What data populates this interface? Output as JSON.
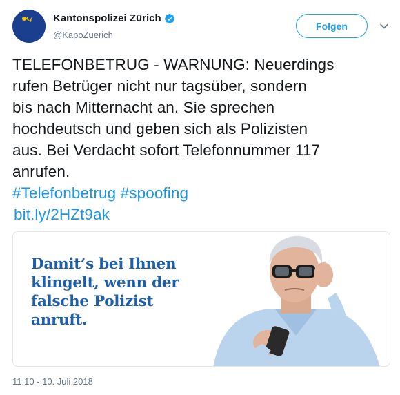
{
  "header": {
    "display_name": "Kantonspolizei Zürich",
    "handle": "@KapoZuerich",
    "avatar_text": "Kantonspolizei Zürich",
    "follow_label": "Folgen"
  },
  "tweet": {
    "text_lines": [
      "TELEFONBETRUG - WARNUNG: Neuerdings",
      "rufen Betrüger nicht nur tagsüber, sondern",
      "bis nach Mitternacht an. Sie sprechen",
      "hochdeutsch und geben sich als Polizisten",
      "aus. Bei Verdacht sofort Telefonnummer 117",
      "anrufen."
    ],
    "hashtags": [
      "#Telefonbetrug",
      "#spoofing"
    ],
    "link": "bit.ly/2HZt9ak",
    "timestamp": "11:10 - 10. Juli 2018"
  },
  "card": {
    "slogan_lines": [
      "Damit’s bei Ihnen",
      "klingelt, wenn der",
      "falsche Polizist",
      "anruft."
    ]
  },
  "colors": {
    "link": "#1b95e0",
    "follow": "#1da1f2",
    "slogan": "#1f5ea8",
    "verified": "#1da1f2"
  },
  "icons": [
    "verified-badge-icon",
    "chevron-down-icon"
  ]
}
